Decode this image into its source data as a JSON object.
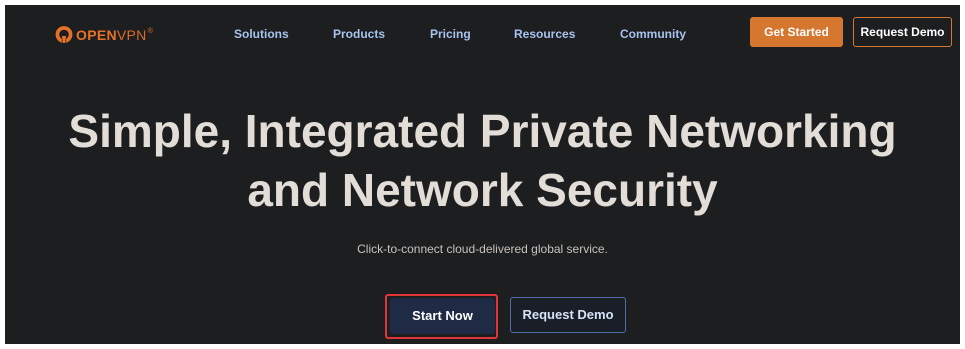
{
  "header": {
    "logo": {
      "brand_bold": "OPEN",
      "brand_light": "VPN",
      "registered": "®"
    },
    "nav": [
      {
        "label": "Solutions"
      },
      {
        "label": "Products"
      },
      {
        "label": "Pricing"
      },
      {
        "label": "Resources"
      },
      {
        "label": "Community"
      }
    ],
    "get_started_label": "Get Started",
    "request_demo_label": "Request Demo"
  },
  "hero": {
    "title_line1": "Simple, Integrated Private Networking",
    "title_line2": "and Network Security",
    "subtitle": "Click-to-connect cloud-delivered global service.",
    "start_now_label": "Start Now",
    "request_demo_label": "Request Demo"
  },
  "colors": {
    "background": "#1d1e20",
    "accent_orange": "#d6772f",
    "nav_link": "#a7c3ee",
    "primary_button": "#1f2b45",
    "highlight_outline": "#e0363a"
  }
}
